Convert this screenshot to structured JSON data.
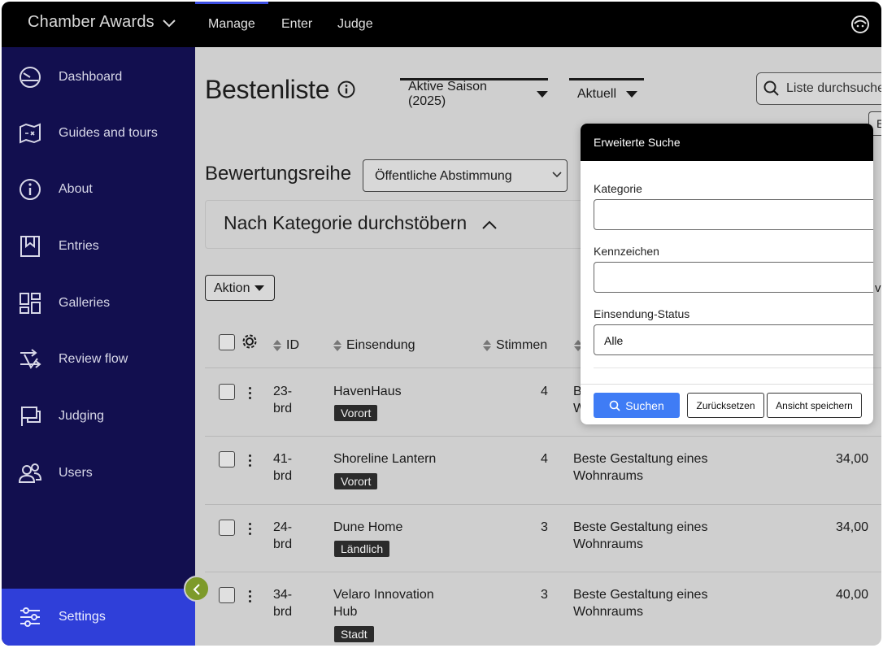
{
  "header": {
    "app_title": "Chamber Awards",
    "tabs": [
      {
        "label": "Manage"
      },
      {
        "label": "Enter"
      },
      {
        "label": "Judge"
      }
    ]
  },
  "sidebar": {
    "items": [
      {
        "label": "Dashboard",
        "icon": "dashboard-gauge-icon"
      },
      {
        "label": "Guides and tours",
        "icon": "map-guide-icon"
      },
      {
        "label": "About",
        "icon": "info-icon"
      },
      {
        "label": "Entries",
        "icon": "bookmark-icon"
      },
      {
        "label": "Galleries",
        "icon": "grid-gallery-icon"
      },
      {
        "label": "Review flow",
        "icon": "review-flow-icon"
      },
      {
        "label": "Judging",
        "icon": "flag-icon"
      },
      {
        "label": "Users",
        "icon": "users-icon"
      }
    ],
    "settings_label": "Settings"
  },
  "page": {
    "title": "Bestenliste",
    "season_select": "Aktive Saison (2025)",
    "status_select": "Aktuell",
    "search_placeholder": "Liste durchsuchen",
    "edge_button": "E",
    "series_label": "Bewertungsreihe",
    "series_value": "Öffentliche Abstimmung",
    "category_toggle": "Nach Kategorie durchstöbern",
    "action_button": "Aktion",
    "partial_text": "vo"
  },
  "table": {
    "headers": {
      "id": "ID",
      "submission": "Einsendung",
      "votes": "Stimmen"
    },
    "rows": [
      {
        "id_line1": "23-",
        "id_line2": "brd",
        "name_line1": "HavenHaus",
        "name_line2": "",
        "tag": "Vorort",
        "votes": "4",
        "category_line1": "Be",
        "category_line2": "Wo",
        "score": ""
      },
      {
        "id_line1": "41-",
        "id_line2": "brd",
        "name_line1": "Shoreline Lantern",
        "name_line2": "",
        "tag": "Vorort",
        "votes": "4",
        "category_line1": "Beste Gestaltung eines",
        "category_line2": "Wohnraums",
        "score": "34,00"
      },
      {
        "id_line1": "24-",
        "id_line2": "brd",
        "name_line1": "Dune Home",
        "name_line2": "",
        "tag": "Ländlich",
        "votes": "3",
        "category_line1": "Beste Gestaltung eines",
        "category_line2": "Wohnraums",
        "score": "34,00"
      },
      {
        "id_line1": "34-",
        "id_line2": "brd",
        "name_line1": "Velaro Innovation",
        "name_line2": "Hub",
        "tag": "Stadt",
        "votes": "3",
        "category_line1": "Beste Gestaltung eines",
        "category_line2": "Wohnraums",
        "score": "40,00"
      }
    ]
  },
  "advanced_search": {
    "title": "Erweiterte Suche",
    "category_label": "Kategorie",
    "category_value": "",
    "tag_label": "Kennzeichen",
    "tag_value": "",
    "status_label": "Einsendung-Status",
    "status_value": "Alle",
    "search_button": "Suchen",
    "reset_button": "Zurücksetzen",
    "save_view_button": "Ansicht speichern"
  },
  "colors": {
    "sidebar_bg": "#120f4f",
    "accent": "#2f3fd9",
    "primary_button": "#3f7cf5",
    "collapse_button": "#7d9a2a"
  }
}
